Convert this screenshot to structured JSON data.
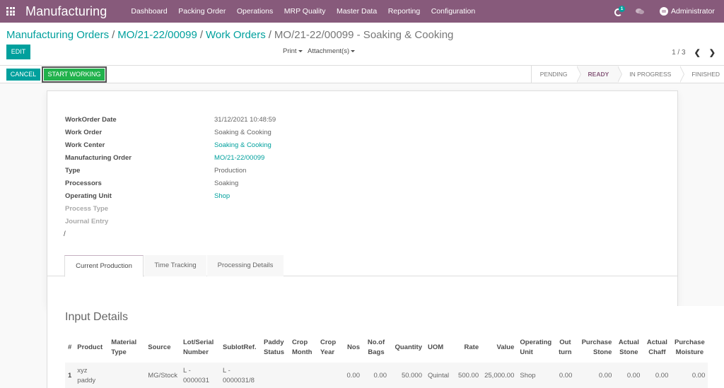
{
  "navbar": {
    "app_name": "Manufacturing",
    "menu": [
      "Dashboard",
      "Packing Order",
      "Operations",
      "MRP Quality",
      "Master Data",
      "Reporting",
      "Configuration"
    ],
    "activity_count": "1",
    "username": "Administrator",
    "icons": {
      "apps": "apps-grid-icon",
      "activity": "clock-icon",
      "chat": "chat-bubbles-icon",
      "avatar": "avatar-icon"
    }
  },
  "breadcrumb": {
    "items": [
      "Manufacturing Orders",
      "MO/21-22/00099",
      "Work Orders"
    ],
    "current": "MO/21-22/00099 - Soaking & Cooking",
    "separator": "/"
  },
  "toolbar": {
    "edit_label": "EDIT",
    "print_label": "Print",
    "attachments_label": "Attachment(s)",
    "pager": "1 / 3",
    "prev_icon": "chevron-left-icon",
    "next_icon": "chevron-right-icon"
  },
  "statusbar": {
    "cancel_label": "CANCEL",
    "start_label": "START WORKING",
    "stages": [
      "PENDING",
      "READY",
      "IN PROGRESS",
      "FINISHED"
    ],
    "active_stage": "READY"
  },
  "form": {
    "fields": [
      {
        "label": "WorkOrder Date",
        "value": "31/12/2021 10:48:59",
        "link": false
      },
      {
        "label": "Work Order",
        "value": "Soaking & Cooking",
        "link": false
      },
      {
        "label": "Work Center",
        "value": "Soaking & Cooking",
        "link": true
      },
      {
        "label": "Manufacturing Order",
        "value": "MO/21-22/00099",
        "link": true
      },
      {
        "label": "Type",
        "value": "Production",
        "link": false
      },
      {
        "label": "Processors",
        "value": "Soaking",
        "link": false
      },
      {
        "label": "Operating Unit",
        "value": "Shop",
        "link": true
      },
      {
        "label": "Process Type",
        "value": "",
        "link": false
      },
      {
        "label": "Journal Entry",
        "value": "",
        "link": false
      }
    ],
    "slash": "/",
    "tabs": [
      "Current Production",
      "Time Tracking",
      "Processing Details"
    ],
    "active_tab": "Current Production"
  },
  "input_details": {
    "title": "Input Details",
    "columns": [
      [
        "#"
      ],
      [
        "Product"
      ],
      [
        "Material",
        "Type"
      ],
      [
        "Source"
      ],
      [
        "Lot/Serial",
        "Number"
      ],
      [
        "SublotRef."
      ],
      [
        "Paddy",
        "Status"
      ],
      [
        "Crop",
        "Month"
      ],
      [
        "Crop",
        "Year"
      ],
      [
        "Nos"
      ],
      [
        "No.of",
        "Bags"
      ],
      [
        "Quantity"
      ],
      [
        "UOM"
      ],
      [
        "Rate"
      ],
      [
        "Value"
      ],
      [
        "Operating",
        "Unit"
      ],
      [
        "Out",
        "turn"
      ],
      [
        "Purchase",
        "Stone"
      ],
      [
        "Actual",
        "Stone"
      ],
      [
        "Actual",
        "Chaff"
      ],
      [
        "Purchase",
        "Moisture"
      ]
    ],
    "rows": [
      [
        "1",
        "xyz\npaddy",
        "",
        "MG/Stock",
        "L -\n0000031",
        "L -\n0000031/8",
        "",
        "",
        "",
        "0.00",
        "0.00",
        "50.000",
        "Quintal",
        "500.00",
        "25,000.00",
        "Shop",
        "0.00",
        "0.00",
        "0.00",
        "0.00",
        "0.00"
      ]
    ]
  }
}
